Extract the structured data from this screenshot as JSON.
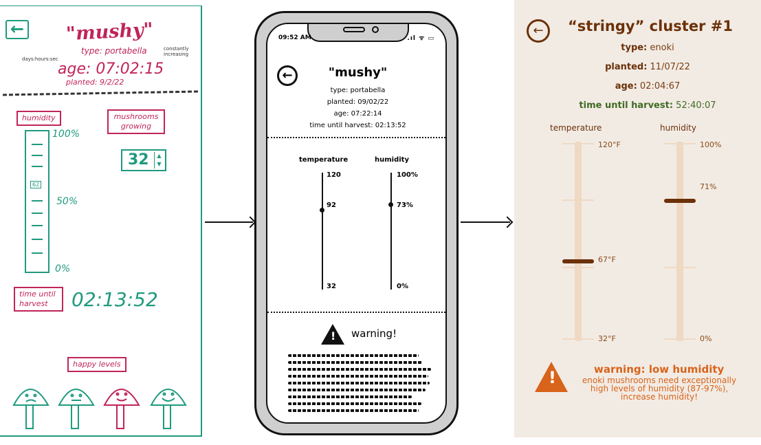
{
  "sketch": {
    "back_icon": "left-arrow-icon",
    "title": "\"mushy\"",
    "type": "type: portabella",
    "age": "age: 07:02:15",
    "planted": "planted: 9/2/22",
    "note_left": "days:hours:sec",
    "note_right": "constantly increasing",
    "humidity_label": "humidity",
    "humidity_top": "100%",
    "humidity_mid": "50%",
    "humidity_bottom": "0%",
    "humidity_marker": "62",
    "mushrooms_label": "mushrooms growing",
    "mushrooms_count": "32",
    "time_label": "time until harvest",
    "time_value": "02:13:52",
    "happy_label": "happy levels"
  },
  "phone": {
    "clock": "09:52 AM",
    "status": ".ıl ᯤ ▭",
    "title": "\"mushy\"",
    "type": "type: portabella",
    "planted": "planted: 09/02/22",
    "age": "age: 07:22:14",
    "harvest": "time until harvest: 02:13:52",
    "temp_label": "temperature",
    "hum_label": "humidity",
    "temp_max": "120",
    "temp_cur": "92",
    "temp_min": "32",
    "hum_max": "100%",
    "hum_cur": "73%",
    "hum_min": "0%",
    "warning": "warning!",
    "warning_icon": "exclamation-triangle-icon"
  },
  "hifi": {
    "title": "“stringy” cluster #1",
    "type_label": "type:",
    "type_value": "enoki",
    "planted_label": "planted:",
    "planted_value": "11/07/22",
    "age_label": "age:",
    "age_value": "02:04:67",
    "harvest_label": "time until harvest:",
    "harvest_value": "52:40:07",
    "temp_label": "temperature",
    "hum_label": "humidity",
    "temp_max": "120°F",
    "temp_cur": "67°F",
    "temp_min": "32°F",
    "hum_max": "100%",
    "hum_cur": "71%",
    "hum_min": "0%",
    "warning_title": "warning: low humidity",
    "warning_text": "enoki mushrooms need exceptionally high levels of humidity (87-97%), increase humidity!",
    "colors": {
      "background": "#f2ebe4",
      "brown": "#6b3108",
      "green": "#3f6b24",
      "orange": "#d8631a",
      "track": "#efd9c3"
    }
  }
}
